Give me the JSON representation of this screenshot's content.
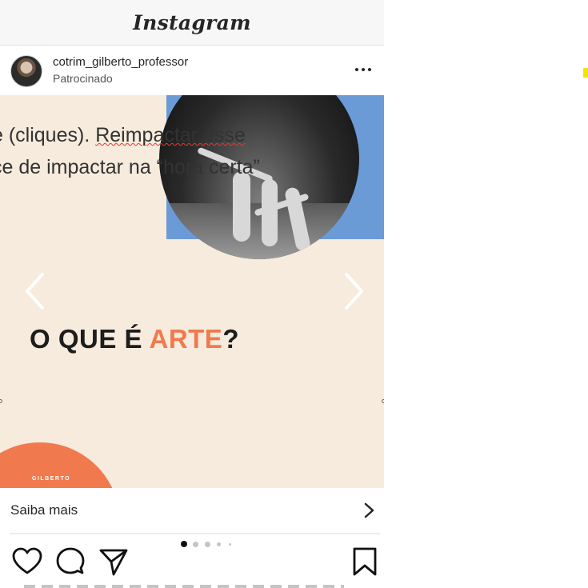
{
  "app": {
    "title": "Instagram"
  },
  "post": {
    "username": "cotrim_gilberto_professor",
    "sponsored_label": "Patrocinado",
    "slide": {
      "text_line1_a": "e (cliques). ",
      "text_line1_b": "Reimpactar esse",
      "text_line2": "ce de impactar na “hora certa”",
      "title_main": "O QUE É ",
      "title_accent": "ARTE",
      "title_end": "?",
      "brand_small": "GILBERTO"
    },
    "cta_label": "Saiba mais",
    "carousel": {
      "current": 1,
      "total": 5
    }
  },
  "colors": {
    "accent_orange": "#f07a4e",
    "blue": "#6b9bd6",
    "background_beige": "#f6ebdc"
  },
  "icons": [
    "more-icon",
    "chevron-left-icon",
    "chevron-right-icon",
    "chevron-right-icon",
    "heart-icon",
    "comment-icon",
    "share-icon",
    "bookmark-icon"
  ]
}
